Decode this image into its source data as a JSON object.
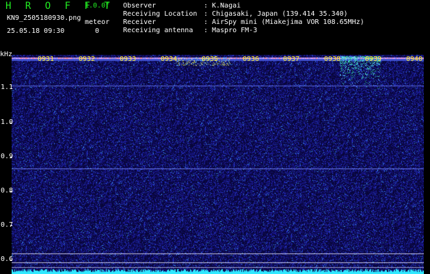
{
  "header": {
    "brand": "H R O F F T",
    "version": "1.0.0f",
    "filename": "KN9_2505180930.png",
    "software_label": "meteor",
    "datetime": "25.05.18 09:30",
    "software_value": "0",
    "info": [
      {
        "key": "Observer",
        "value": "K.Nagai"
      },
      {
        "key": "Receiving Location",
        "value": "Chigasaki, Japan (139.414 35.340)"
      },
      {
        "key": "Receiver",
        "value": "AirSpy mini (Miakejima VOR 108.65MHz)"
      },
      {
        "key": "Receiving antenna",
        "value": "Maspro FM-3"
      }
    ]
  },
  "axis": {
    "unit": "kHz",
    "y_ticks": [
      "1.1",
      "1.0",
      "0.9",
      "0.8",
      "0.7",
      "0.6"
    ],
    "time_labels": [
      "0931",
      "0932",
      "0933",
      "0934",
      "0935",
      "0936",
      "0937",
      "0938",
      "0939",
      "0940"
    ]
  },
  "colors": {
    "background": "#000000",
    "plot_bg": "#08063a",
    "brand": "#22ee22",
    "time_label": "#ffee33",
    "signal": "#30e8ff"
  }
}
